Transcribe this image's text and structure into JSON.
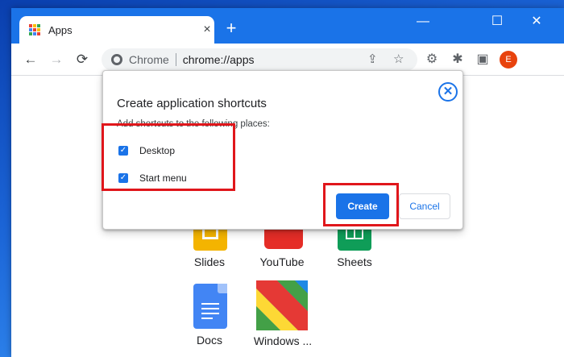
{
  "tab": {
    "title": "Apps",
    "close": "×",
    "new_tab": "+"
  },
  "window_controls": {
    "minimize": "—",
    "maximize": "☐",
    "close": "✕"
  },
  "toolbar": {
    "back": "←",
    "forward": "→",
    "reload": "⟳",
    "site_label": "Chrome",
    "url": "chrome://apps",
    "share_icon": "⇪",
    "bookmark_icon": "☆",
    "settings_icon": "⚙",
    "extensions_icon": "✱",
    "sidepanel_icon": "▣",
    "profile_initial": "E"
  },
  "dialog": {
    "title": "Create application shortcuts",
    "subtitle": "Add shortcuts to the following places:",
    "close": "✕",
    "options": [
      {
        "label": "Desktop",
        "checked": true,
        "mark": "✓"
      },
      {
        "label": "Start menu",
        "checked": true,
        "mark": "✓"
      }
    ],
    "create_label": "Create",
    "cancel_label": "Cancel"
  },
  "apps": [
    {
      "label": "Slides",
      "color": "#f4b400"
    },
    {
      "label": "YouTube",
      "color": "#e52d27"
    },
    {
      "label": "Sheets",
      "color": "#0f9d58"
    },
    {
      "label": "Docs",
      "color": "#4285f4"
    },
    {
      "label": "Windows ..."
    }
  ],
  "colors": {
    "accent": "#1a73e8",
    "annotation": "#e0161b",
    "titlebar": "#1a73e8",
    "avatar": "#e8430d"
  }
}
